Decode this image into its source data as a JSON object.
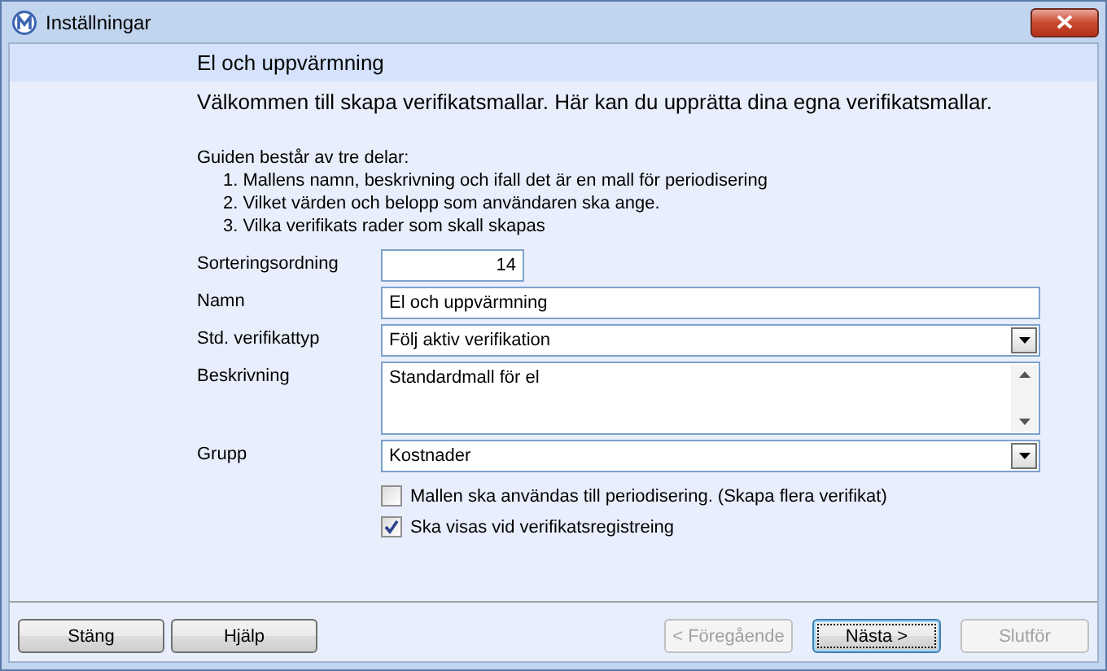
{
  "window": {
    "title": "Inställningar"
  },
  "header": {
    "title": "El och uppvärmning"
  },
  "intro": "Välkommen till skapa verifikatsmallar. Här kan du upprätta dina egna verifikatsmallar.",
  "guide": {
    "heading": "Guiden består av tre delar:",
    "steps": [
      "1. Mallens namn, beskrivning och ifall det är en mall för periodisering",
      "2. Vilket värden och belopp som användaren ska ange.",
      "3. Vilka verifikats rader som skall skapas"
    ]
  },
  "fields": [
    {
      "kind": "number",
      "label": "Sorteringsordning",
      "value": "14"
    },
    {
      "kind": "text",
      "label": "Namn",
      "value": "El och uppvärmning"
    },
    {
      "kind": "select",
      "label": "Std. verifikattyp",
      "value": "Följ aktiv verifikation"
    },
    {
      "kind": "textarea",
      "label": "Beskrivning",
      "value": "Standardmall för el"
    },
    {
      "kind": "select",
      "label": "Grupp",
      "value": "Kostnader"
    }
  ],
  "checkboxes": [
    {
      "label": "Mallen ska användas till periodisering. (Skapa flera verifikat)",
      "checked": false
    },
    {
      "label": "Ska visas vid verifikatsregistreing",
      "checked": true
    }
  ],
  "buttons_left": [
    {
      "label": "Stäng",
      "disabled": false
    },
    {
      "label": "Hjälp",
      "disabled": false
    }
  ],
  "buttons_right": [
    {
      "label": "< Föregående",
      "disabled": true,
      "selected": false
    },
    {
      "label": "Nästa >",
      "disabled": false,
      "selected": true
    },
    {
      "label": "Slutför",
      "disabled": true,
      "selected": false
    }
  ]
}
